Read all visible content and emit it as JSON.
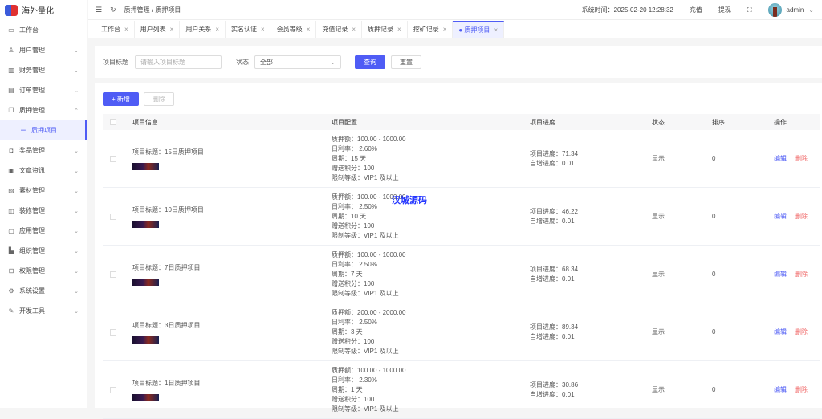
{
  "app": {
    "title": "海外量化"
  },
  "sidebar": {
    "items": [
      {
        "label": "工作台",
        "icon": "monitor-icon",
        "glyph": "▭"
      },
      {
        "label": "用户管理",
        "icon": "user-icon",
        "glyph": "♙",
        "chev": "⌄"
      },
      {
        "label": "财务管理",
        "icon": "chart-icon",
        "glyph": "▥",
        "chev": "⌄"
      },
      {
        "label": "订单管理",
        "icon": "order-icon",
        "glyph": "▤",
        "chev": "⌄"
      },
      {
        "label": "质押管理",
        "icon": "pledge-icon",
        "glyph": "❐",
        "chev": "⌃"
      },
      {
        "label": "质押项目",
        "icon": "list-icon",
        "glyph": "☰",
        "sub": true
      },
      {
        "label": "奖品管理",
        "icon": "bag-icon",
        "glyph": "◘",
        "chev": "⌄"
      },
      {
        "label": "文章资讯",
        "icon": "article-icon",
        "glyph": "▣",
        "chev": "⌄"
      },
      {
        "label": "素材管理",
        "icon": "image-icon",
        "glyph": "▨",
        "chev": "⌄"
      },
      {
        "label": "装修管理",
        "icon": "decorate-icon",
        "glyph": "◫",
        "chev": "⌄"
      },
      {
        "label": "应用管理",
        "icon": "app-icon",
        "glyph": "▢",
        "chev": "⌄"
      },
      {
        "label": "组织管理",
        "icon": "building-icon",
        "glyph": "▙",
        "chev": "⌄"
      },
      {
        "label": "权限管理",
        "icon": "lock-icon",
        "glyph": "⊡",
        "chev": "⌄"
      },
      {
        "label": "系统设置",
        "icon": "gear-icon",
        "glyph": "⚙",
        "chev": "⌄"
      },
      {
        "label": "开发工具",
        "icon": "pen-icon",
        "glyph": "✎",
        "chev": "⌄"
      }
    ]
  },
  "header": {
    "breadcrumb": [
      "质押管理",
      "质押项目"
    ],
    "sep": "/",
    "system_time": "系统时间：2025-02-20 12:28:32",
    "recharge": "充值",
    "withdraw": "提现",
    "user": "admin"
  },
  "tabs": [
    "工作台",
    "用户列表",
    "用户关系",
    "实名认证",
    "会员等级",
    "充值记录",
    "质押记录",
    "挖矿记录",
    "● 质押项目"
  ],
  "search": {
    "title_label": "项目标题",
    "title_placeholder": "请输入项目标题",
    "status_label": "状态",
    "status_value": "全部",
    "query": "查询",
    "reset": "重置"
  },
  "toolbar": {
    "add": "+ 新增",
    "delete": "删除"
  },
  "table": {
    "headers": [
      "项目信息",
      "项目配置",
      "项目进度",
      "状态",
      "排序",
      "操作"
    ],
    "rows": [
      {
        "title": "项目标题：15日质押项目",
        "config": [
          "质押额：100.00 - 1000.00",
          "日利率： 2.60%",
          "周期：15 天",
          "赠送积分：100",
          "限制等级：VIP1 及以上"
        ],
        "progress": "项目进度：71.34",
        "auto": "自增进度：0.01",
        "status": "显示",
        "sort": "0"
      },
      {
        "title": "项目标题：10日质押项目",
        "config": [
          "质押额：100.00 - 1000.00",
          "日利率： 2.50%",
          "周期：10 天",
          "赠送积分：100",
          "限制等级：VIP1 及以上"
        ],
        "progress": "项目进度：46.22",
        "auto": "自增进度：0.01",
        "status": "显示",
        "sort": "0"
      },
      {
        "title": "项目标题：7日质押项目",
        "config": [
          "质押额：100.00 - 1000.00",
          "日利率： 2.50%",
          "周期：7 天",
          "赠送积分：100",
          "限制等级：VIP1 及以上"
        ],
        "progress": "项目进度：68.34",
        "auto": "自增进度：0.01",
        "status": "显示",
        "sort": "0"
      },
      {
        "title": "项目标题：3日质押项目",
        "config": [
          "质押额：200.00 - 2000.00",
          "日利率： 2.50%",
          "周期：3 天",
          "赠送积分：100",
          "限制等级：VIP1 及以上"
        ],
        "progress": "项目进度：89.34",
        "auto": "自增进度：0.01",
        "status": "显示",
        "sort": "0"
      },
      {
        "title": "项目标题：1日质押项目",
        "config": [
          "质押额：100.00 - 1000.00",
          "日利率： 2.30%",
          "周期：1 天",
          "赠送积分：100",
          "限制等级：VIP1 及以上"
        ],
        "progress": "项目进度：30.86",
        "auto": "自增进度：0.01",
        "status": "显示",
        "sort": "0"
      }
    ],
    "edit": "编辑",
    "del": "删除"
  },
  "watermark": "汉城源码",
  "colors": {
    "accent": "#4f5cf5",
    "danger": "#f06a6a"
  }
}
